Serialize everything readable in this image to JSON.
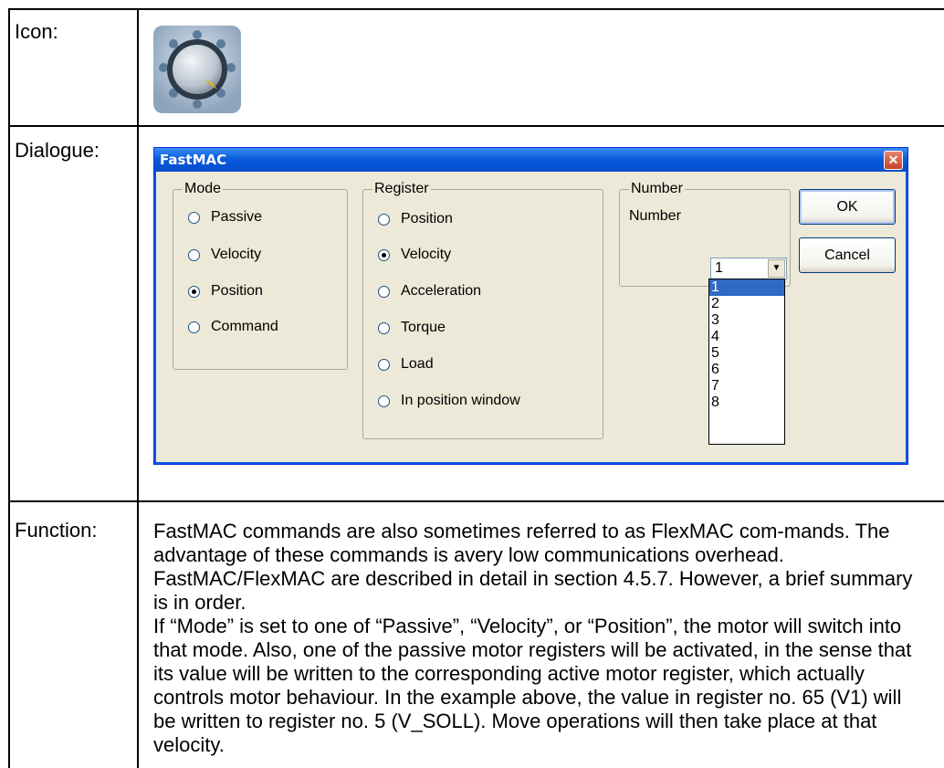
{
  "table": {
    "icon_label": "Icon:",
    "dialogue_label": "Dialogue:",
    "function_label": "Function:"
  },
  "icon": {
    "name": "knob-icon"
  },
  "dialog": {
    "title": "FastMAC",
    "mode_group": {
      "legend": "Mode",
      "options": [
        "Passive",
        "Velocity",
        "Position",
        "Command"
      ],
      "selected": "Position"
    },
    "register_group": {
      "legend": "Register",
      "options": [
        "Position",
        "Velocity",
        "Acceleration",
        "Torque",
        "Load",
        "In position window"
      ],
      "selected": "Velocity"
    },
    "number_group": {
      "legend": "Number",
      "label": "Number",
      "value": "1",
      "options": [
        "1",
        "2",
        "3",
        "4",
        "5",
        "6",
        "7",
        "8"
      ],
      "highlighted": "1"
    },
    "ok_label": "OK",
    "cancel_label": "Cancel"
  },
  "function_text": {
    "p1": "FastMAC commands are also sometimes referred to as FlexMAC com-mands. The advantage of these commands is avery low communications overhead. FastMAC/FlexMAC are described in detail in section 4.5.7. However, a brief summary is in order.",
    "p2": "If “Mode” is set to one of “Passive”, “Velocity”, or “Position”, the motor will switch into that mode. Also, one of the passive motor registers will be activated, in the sense that its value will be written to the corresponding active motor register, which actually controls motor behaviour. In the example above, the value in register no. 65 (V1) will be written to register no. 5 (V_SOLL). Move operations will then take place at that velocity."
  },
  "colors": {
    "titlebar": "#0a5ddc",
    "dialog_bg": "#ece9d8",
    "selection": "#316ac5"
  }
}
